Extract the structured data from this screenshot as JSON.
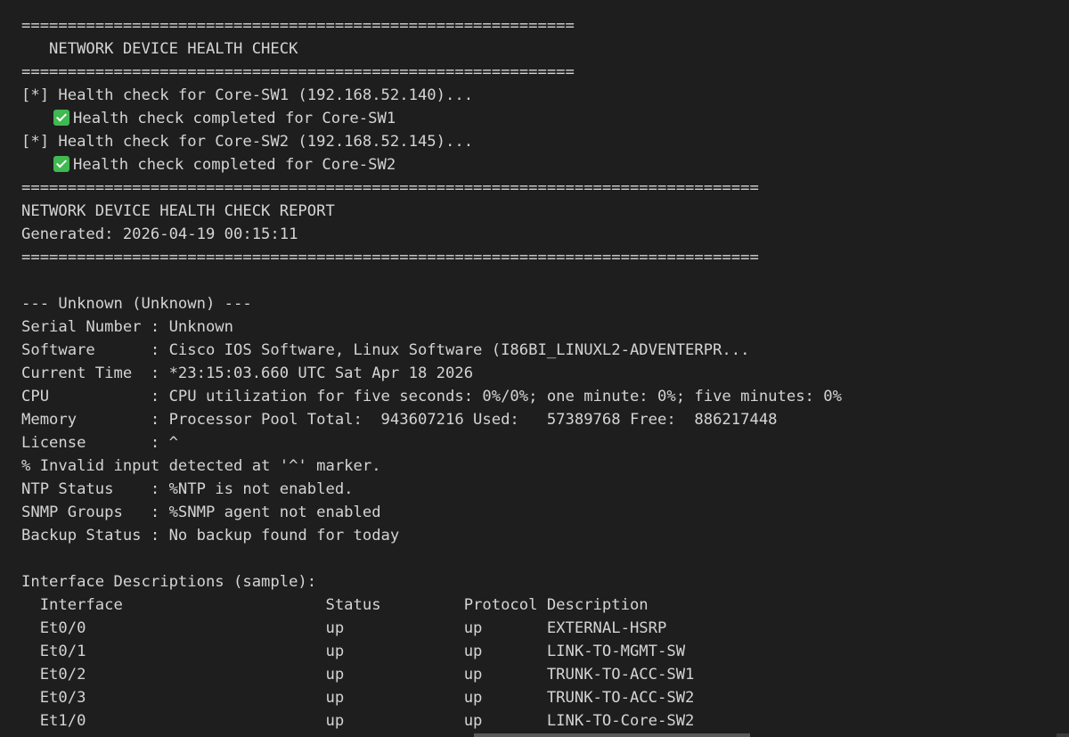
{
  "lines": {
    "sep_short_1": "============================================================",
    "title": "   NETWORK DEVICE HEALTH CHECK",
    "sep_short_2": "============================================================",
    "check_1": "[*] Health check for Core-SW1 (192.168.52.140)...",
    "done_1": "Health check completed for Core-SW1",
    "check_2": "[*] Health check for Core-SW2 (192.168.52.145)...",
    "done_2": "Health check completed for Core-SW2",
    "sep_long_1": "================================================================================",
    "report_title": "NETWORK DEVICE HEALTH CHECK REPORT",
    "generated": "Generated: 2026-04-19 00:15:11",
    "sep_long_2": "================================================================================",
    "device_header": "--- Unknown (Unknown) ---",
    "serial": "Serial Number : Unknown",
    "software": "Software      : Cisco IOS Software, Linux Software (I86BI_LINUXL2-ADVENTERPR...",
    "current_time": "Current Time  : *23:15:03.660 UTC Sat Apr 18 2026",
    "cpu": "CPU           : CPU utilization for five seconds: 0%/0%; one minute: 0%; five minutes: 0%",
    "memory": "Memory        : Processor Pool Total:  943607216 Used:   57389768 Free:  886217448",
    "license": "License       : ^",
    "invalid": "% Invalid input detected at '^' marker.",
    "ntp": "NTP Status    : %NTP is not enabled.",
    "snmp": "SNMP Groups   : %SNMP agent not enabled",
    "backup": "Backup Status : No backup found for today",
    "intf_title": "Interface Descriptions (sample):",
    "intf_header": "  Interface                      Status         Protocol Description",
    "intf_rows": [
      "  Et0/0                          up             up       EXTERNAL-HSRP",
      "  Et0/1                          up             up       LINK-TO-MGMT-SW",
      "  Et0/2                          up             up       TRUNK-TO-ACC-SW1",
      "  Et0/3                          up             up       TRUNK-TO-ACC-SW2",
      "  Et1/0                          up             up       LINK-TO-Core-SW2"
    ]
  },
  "colors": {
    "background": "#1e1e1e",
    "text": "#d4d4d4",
    "check_icon": "#3fb950"
  }
}
